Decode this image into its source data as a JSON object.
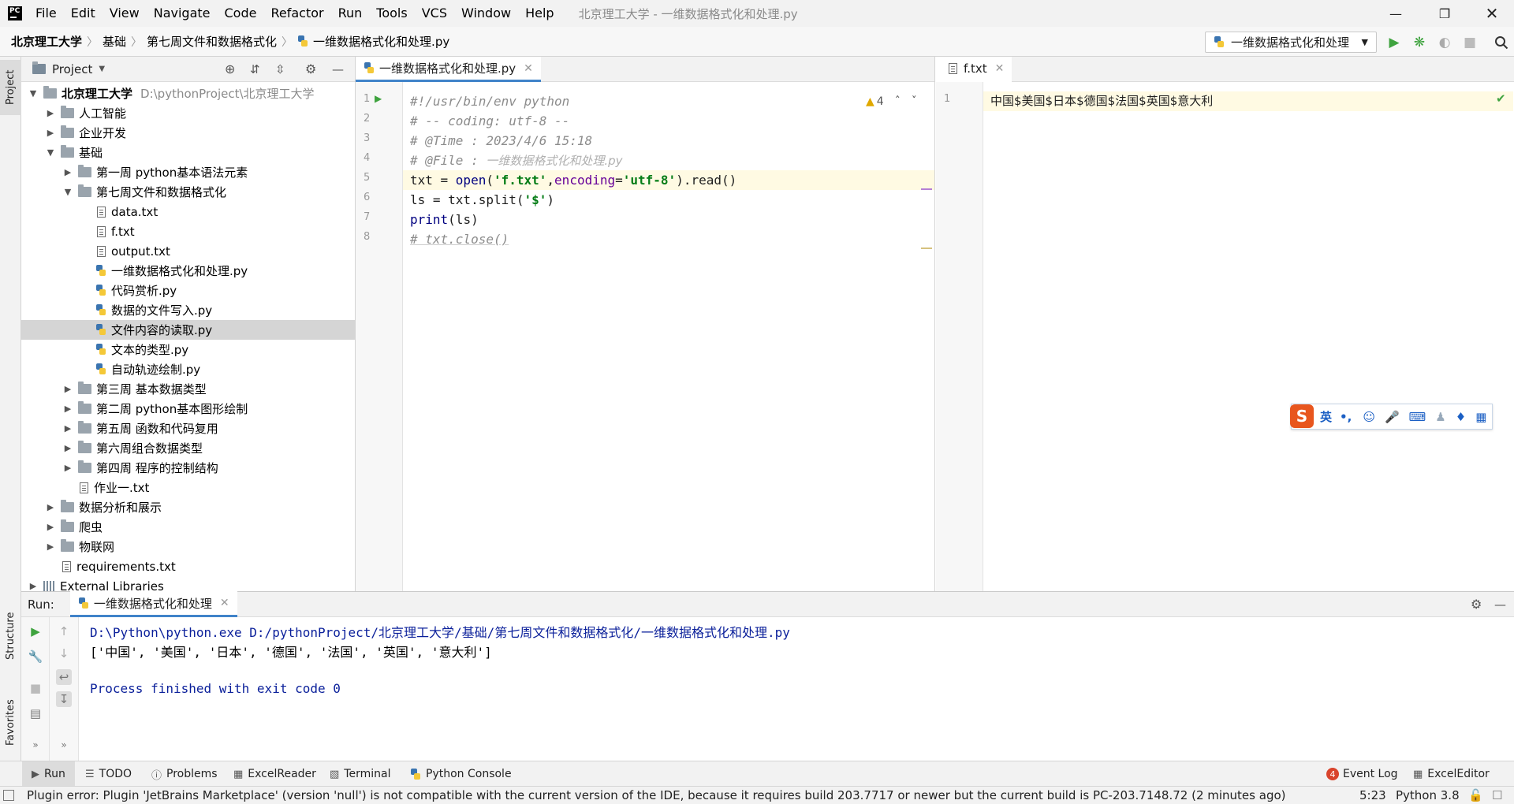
{
  "window": {
    "title": "北京理工大学 - 一维数据格式化和处理.py",
    "menu": [
      "File",
      "Edit",
      "View",
      "Navigate",
      "Code",
      "Refactor",
      "Run",
      "Tools",
      "VCS",
      "Window",
      "Help"
    ]
  },
  "breadcrumb": [
    "北京理工大学",
    "基础",
    "第七周文件和数据格式化",
    "一维数据格式化和处理.py"
  ],
  "run_config": "一维数据格式化和处理",
  "left_strip": {
    "project": "Project",
    "structure": "Structure",
    "favorites": "Favorites"
  },
  "project": {
    "header": "Project",
    "root_name": "北京理工大学",
    "root_path": "D:\\pythonProject\\北京理工大学",
    "tree": [
      {
        "label": "人工智能",
        "type": "folder",
        "depth": 1,
        "expanded": false
      },
      {
        "label": "企业开发",
        "type": "folder",
        "depth": 1,
        "expanded": false
      },
      {
        "label": "基础",
        "type": "folder",
        "depth": 1,
        "expanded": true
      },
      {
        "label": "第一周 python基本语法元素",
        "type": "folder",
        "depth": 2,
        "expanded": false
      },
      {
        "label": "第七周文件和数据格式化",
        "type": "folder",
        "depth": 2,
        "expanded": true
      },
      {
        "label": "data.txt",
        "type": "txt",
        "depth": 3
      },
      {
        "label": "f.txt",
        "type": "txt",
        "depth": 3
      },
      {
        "label": "output.txt",
        "type": "txt",
        "depth": 3
      },
      {
        "label": "一维数据格式化和处理.py",
        "type": "py",
        "depth": 3
      },
      {
        "label": "代码赏析.py",
        "type": "py",
        "depth": 3
      },
      {
        "label": "数据的文件写入.py",
        "type": "py",
        "depth": 3
      },
      {
        "label": "文件内容的读取.py",
        "type": "py",
        "depth": 3,
        "selected": true
      },
      {
        "label": "文本的类型.py",
        "type": "py",
        "depth": 3
      },
      {
        "label": "自动轨迹绘制.py",
        "type": "py",
        "depth": 3
      },
      {
        "label": "第三周 基本数据类型",
        "type": "folder",
        "depth": 2,
        "expanded": false
      },
      {
        "label": "第二周 python基本图形绘制",
        "type": "folder",
        "depth": 2,
        "expanded": false
      },
      {
        "label": "第五周 函数和代码复用",
        "type": "folder",
        "depth": 2,
        "expanded": false
      },
      {
        "label": "第六周组合数据类型",
        "type": "folder",
        "depth": 2,
        "expanded": false
      },
      {
        "label": "第四周 程序的控制结构",
        "type": "folder",
        "depth": 2,
        "expanded": false
      },
      {
        "label": "作业一.txt",
        "type": "txt",
        "depth": 2
      },
      {
        "label": "数据分析和展示",
        "type": "folder",
        "depth": 1,
        "expanded": false
      },
      {
        "label": "爬虫",
        "type": "folder",
        "depth": 1,
        "expanded": false
      },
      {
        "label": "物联网",
        "type": "folder",
        "depth": 1,
        "expanded": false
      },
      {
        "label": "requirements.txt",
        "type": "txt",
        "depth": 1
      },
      {
        "label": "External Libraries",
        "type": "lib",
        "depth": 0,
        "expanded": false
      }
    ]
  },
  "editor1": {
    "tab": "一维数据格式化和处理.py",
    "warnings": "4",
    "line_numbers": [
      "1",
      "2",
      "3",
      "4",
      "5",
      "6",
      "7",
      "8"
    ],
    "lines": [
      {
        "c": "#!/usr/bin/env python"
      },
      {
        "c": "# -- coding: utf-8 --"
      },
      {
        "c": "# @Time : 2023/4/6 15:18"
      },
      {
        "c1": "# @File : ",
        "c2": "一维数据格式化和处理.py"
      },
      {
        "p1": "txt = ",
        "bi": "open",
        "p2": "(",
        "s1": "'f.txt'",
        "p3": ",",
        "pa": "encoding",
        "p4": "=",
        "s2": "'utf-8'",
        "p5": ").read()"
      },
      {
        "p1": "ls = txt.split(",
        "s1": "'$'",
        "p2": ")"
      },
      {
        "bi": "print",
        "p1": "(ls)"
      },
      {
        "c": "# txt.close()"
      }
    ]
  },
  "editor2": {
    "tab": "f.txt",
    "line_number": "1",
    "content": "中国$美国$日本$德国$法国$英国$意大利"
  },
  "ime": {
    "lang": "英",
    "punct": "•,"
  },
  "run": {
    "label": "Run:",
    "tab": "一维数据格式化和处理",
    "output": [
      "D:\\Python\\python.exe D:/pythonProject/北京理工大学/基础/第七周文件和数据格式化/一维数据格式化和处理.py",
      "['中国', '美国', '日本', '德国', '法国', '英国', '意大利']",
      "",
      "Process finished with exit code 0"
    ]
  },
  "bottom_tools": {
    "run": "Run",
    "todo": "TODO",
    "problems": "Problems",
    "excelreader": "ExcelReader",
    "terminal": "Terminal",
    "python_console": "Python Console",
    "event_log": "Event Log",
    "event_count": "4",
    "excel_editor": "ExcelEditor"
  },
  "status": {
    "message": "Plugin error: Plugin 'JetBrains Marketplace' (version 'null') is not compatible with the current version of the IDE, because it requires build 203.7717 or newer but the current build is PC-203.7148.72 (2 minutes ago)",
    "position": "5:23",
    "interpreter": "Python 3.8"
  },
  "colors": {
    "accent": "#4083c9",
    "run_green": "#3fa33f",
    "console_blue": "#0a1f9a"
  }
}
